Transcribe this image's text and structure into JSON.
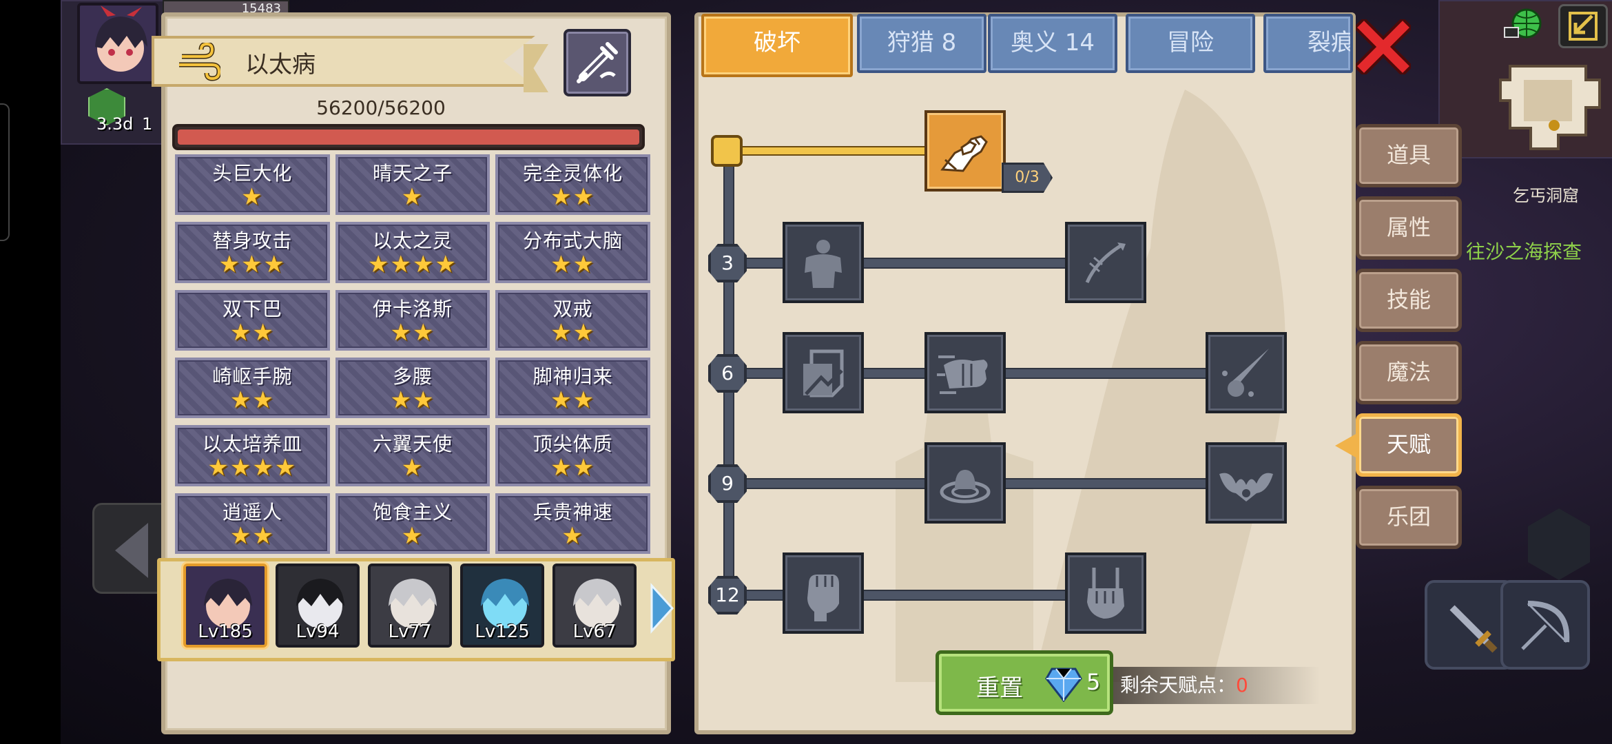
{
  "hud": {
    "player_hp_readout": "15483",
    "buff_timer_1": "3.3d",
    "buff_timer_2": "1"
  },
  "disease": {
    "name": "以太病",
    "hp_text": "56200/56200",
    "hp_fraction": 1.0
  },
  "traits": [
    {
      "name": "头巨大化",
      "stars": 1
    },
    {
      "name": "晴天之子",
      "stars": 1
    },
    {
      "name": "完全灵体化",
      "stars": 2
    },
    {
      "name": "替身攻击",
      "stars": 3
    },
    {
      "name": "以太之灵",
      "stars": 4
    },
    {
      "name": "分布式大脑",
      "stars": 2
    },
    {
      "name": "双下巴",
      "stars": 2
    },
    {
      "name": "伊卡洛斯",
      "stars": 2
    },
    {
      "name": "双戒",
      "stars": 2
    },
    {
      "name": "崎岖手腕",
      "stars": 2
    },
    {
      "name": "多腰",
      "stars": 2
    },
    {
      "name": "脚神归来",
      "stars": 2
    },
    {
      "name": "以太培养皿",
      "stars": 4
    },
    {
      "name": "六翼天使",
      "stars": 1
    },
    {
      "name": "顶尖体质",
      "stars": 2
    },
    {
      "name": "逍遥人",
      "stars": 2
    },
    {
      "name": "饱食主义",
      "stars": 1
    },
    {
      "name": "兵贵神速",
      "stars": 1
    }
  ],
  "party": [
    {
      "level": "Lv185",
      "active": true
    },
    {
      "level": "Lv94",
      "active": false
    },
    {
      "level": "Lv77",
      "active": false
    },
    {
      "level": "Lv125",
      "active": false
    },
    {
      "level": "Lv67",
      "active": false
    }
  ],
  "tabs": [
    {
      "label": "破坏",
      "active": true
    },
    {
      "label": "狩猎 8",
      "active": false
    },
    {
      "label": "奥义 14",
      "active": false
    },
    {
      "label": "冒险",
      "active": false
    },
    {
      "label": "裂痕",
      "active": false
    }
  ],
  "tree": {
    "levels": [
      "3",
      "6",
      "9",
      "12"
    ],
    "node_progress": "0/3"
  },
  "reset": {
    "label": "重置",
    "cost": "5"
  },
  "points": {
    "label": "剩余天赋点：",
    "value": "0"
  },
  "side_menu": [
    {
      "label": "道具",
      "active": false
    },
    {
      "label": "属性",
      "active": false
    },
    {
      "label": "技能",
      "active": false
    },
    {
      "label": "魔法",
      "active": false
    },
    {
      "label": "天赋",
      "active": true
    },
    {
      "label": "乐团",
      "active": false
    }
  ],
  "map": {
    "location": "乞丐洞窟",
    "quest": "往沙之海探查"
  },
  "colors": {
    "active_tab": "#f1a93a",
    "inactive_tab": "#6888b6",
    "star": "#ffc93a",
    "hp": "#d25a50",
    "points_zero": "#ff4a3a"
  }
}
